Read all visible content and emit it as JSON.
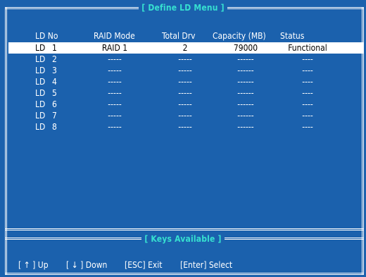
{
  "menu_title": "[ Define LD Menu ]",
  "keys_title": "[ Keys Available ]",
  "columns": [
    "LD No",
    "RAID Mode",
    "Total Drv",
    "Capacity (MB)",
    "Status"
  ],
  "rows": [
    {
      "ld": "LD",
      "num": "1",
      "mode": "RAID 1",
      "drv": "2",
      "cap": "79000",
      "status": "Functional"
    },
    {
      "ld": "LD",
      "num": "2",
      "mode": "-----",
      "drv": "-----",
      "cap": "------",
      "status": "----"
    },
    {
      "ld": "LD",
      "num": "3",
      "mode": "-----",
      "drv": "-----",
      "cap": "------",
      "status": "----"
    },
    {
      "ld": "LD",
      "num": "4",
      "mode": "-----",
      "drv": "-----",
      "cap": "------",
      "status": "----"
    },
    {
      "ld": "LD",
      "num": "5",
      "mode": "-----",
      "drv": "-----",
      "cap": "------",
      "status": "----"
    },
    {
      "ld": "LD",
      "num": "6",
      "mode": "-----",
      "drv": "-----",
      "cap": "------",
      "status": "----"
    },
    {
      "ld": "LD",
      "num": "7",
      "mode": "-----",
      "drv": "-----",
      "cap": "------",
      "status": "----"
    },
    {
      "ld": "LD",
      "num": "8",
      "mode": "-----",
      "drv": "-----",
      "cap": "------",
      "status": "----"
    }
  ],
  "keys": {
    "up": {
      "open": "[",
      "arrow": "↑",
      "close": "]",
      "label": "Up"
    },
    "down": {
      "open": "[",
      "arrow": "↓",
      "close": "]",
      "label": "Down"
    },
    "esc": "[ESC] Exit",
    "enter": "[Enter] Select"
  },
  "colors": {
    "background": "#1b61ad",
    "title": "#36e0d0",
    "highlight": "#ffffff"
  }
}
